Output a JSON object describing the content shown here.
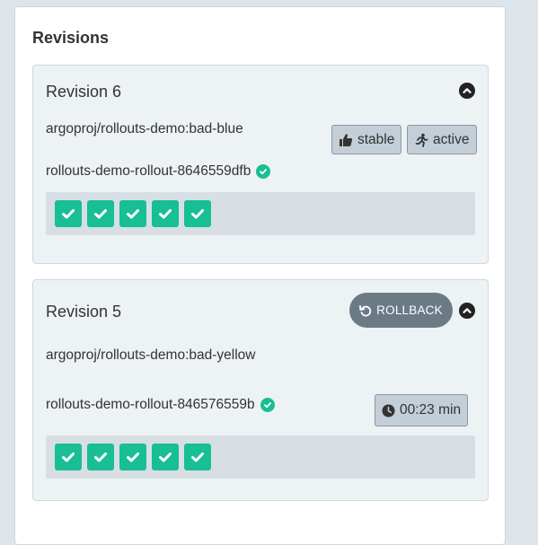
{
  "panel": {
    "title": "Revisions"
  },
  "revisions": [
    {
      "title": "Revision 6",
      "image": "argoproj/rollouts-demo:bad-blue",
      "replicaset": "rollouts-demo-rollout-8646559dfb",
      "tags": {
        "stable": "stable",
        "active": "active"
      },
      "pods": 5
    },
    {
      "title": "Revision 5",
      "image": "argoproj/rollouts-demo:bad-yellow",
      "replicaset": "rollouts-demo-rollout-846576559b",
      "rollback_label": "ROLLBACK",
      "timer": "00:23 min",
      "pods": 5
    }
  ],
  "colors": {
    "healthy": "#18be94",
    "tag_bg": "#c3ced7",
    "rollback_bg": "#6b7b86",
    "card_bg": "#edf2f5"
  },
  "icons": [
    "chevron-up-icon",
    "check-circle-icon",
    "thumbs-up-icon",
    "running-icon",
    "undo-icon",
    "clock-icon",
    "check-icon"
  ]
}
